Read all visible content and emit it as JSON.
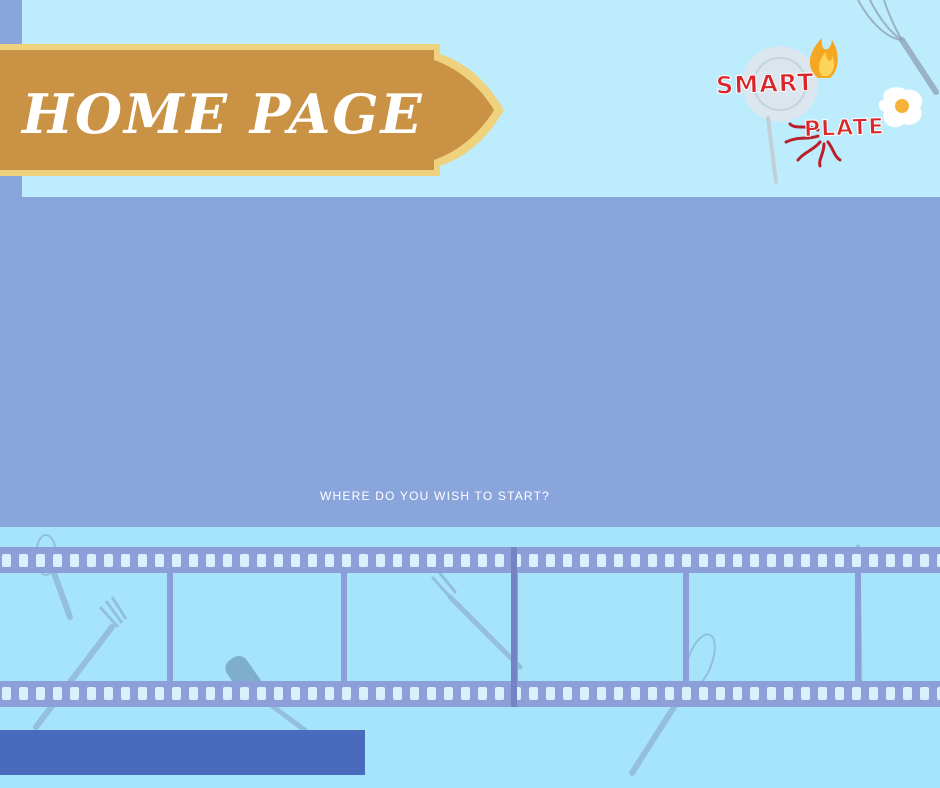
{
  "header": {
    "title": "HOME PAGE"
  },
  "logo": {
    "word_top": "SMART",
    "word_bottom": "PLATE",
    "colors": {
      "text": "#d9262a",
      "flame": "#f5a623",
      "tentacle": "#b8202a"
    },
    "icons": [
      "plate-icon",
      "fork-icon",
      "flame-icon",
      "egg-icon",
      "octopus-icon"
    ]
  },
  "main": {
    "prompt": "WHERE DO YOU WISH TO START?"
  },
  "decor": {
    "icons": [
      "whisk-icon",
      "fork-icon",
      "spatula-icon",
      "film-strip-icon"
    ]
  },
  "colors": {
    "top_background": "#bdecfd",
    "panel": "#8aa4dc",
    "banner_fill": "#c99244",
    "banner_border": "#efd27e",
    "film_strip": "#8d9fd9",
    "bottom_bar": "#486bbd",
    "page_background": "#a6e4fb"
  }
}
